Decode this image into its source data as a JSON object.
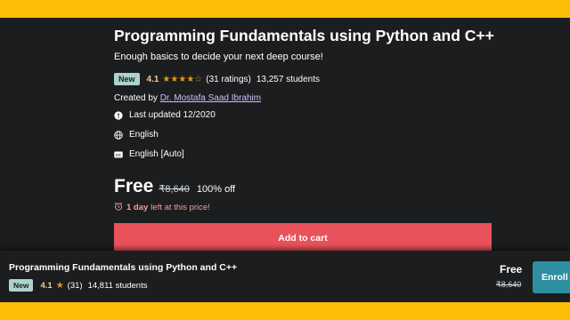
{
  "course": {
    "title": "Programming Fundamentals using Python and C++",
    "subtitle": "Enough basics to decide your next deep course!",
    "badge": "New",
    "rating": "4.1",
    "stars": 4.1,
    "ratings_count": "(31 ratings)",
    "students": "13,257 students",
    "created_by_label": "Created by",
    "instructor": "Dr. Mostafa Saad Ibrahim",
    "last_updated": "Last updated 12/2020",
    "language": "English",
    "captions": "English [Auto]"
  },
  "pricing": {
    "current": "Free",
    "original": "₹8,640",
    "discount": "100% off",
    "deadline_bold": "1 day",
    "deadline_rest": "left at this price!",
    "add_to_cart": "Add to cart"
  },
  "sticky_bar": {
    "title": "Programming Fundamentals using Python and C++",
    "badge": "New",
    "rating": "4.1",
    "ratings_count": "(31)",
    "students": "14,811 students",
    "price": "Free",
    "original_price": "₹8,640",
    "enroll_label": "Enroll n"
  },
  "colors": {
    "frame": "#fbbd08",
    "background": "#1c1d1f",
    "badge": "#acd2cc",
    "rating": "#f3ca8c",
    "star": "#e59819",
    "link": "#cec0fc",
    "deadline": "#f69c9c",
    "add_to_cart": "#e9525b",
    "enroll": "#2d8fa0"
  },
  "icons": {
    "last_updated": "alert-circle-icon",
    "language": "globe-icon",
    "captions": "closed-captions-icon",
    "deadline": "alarm-clock-icon",
    "star": "star-icon"
  }
}
